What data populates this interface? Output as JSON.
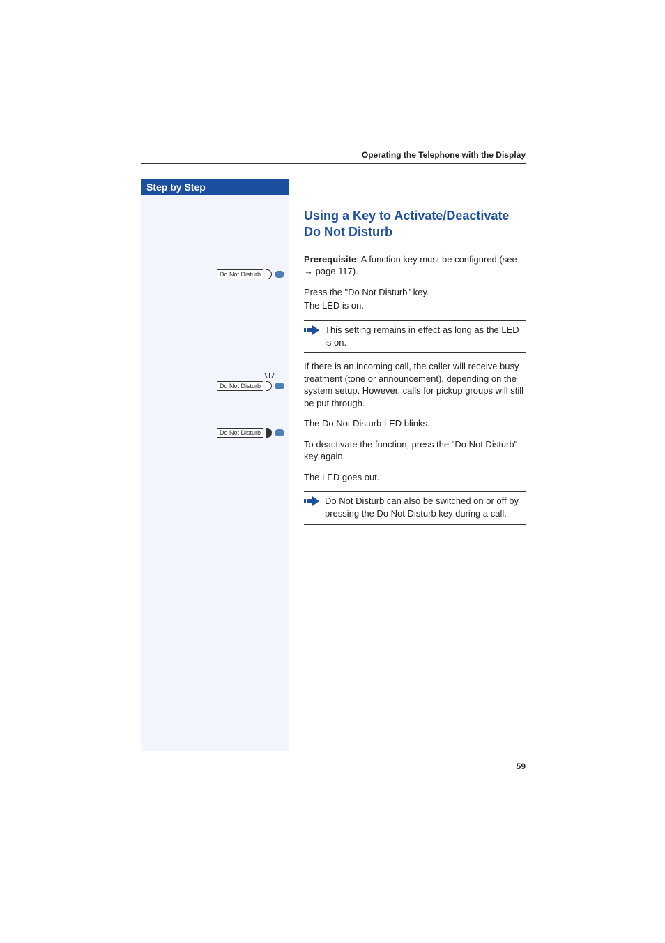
{
  "header": {
    "running_head": "Operating the Telephone with the Display"
  },
  "sidebar": {
    "title": "Step by Step",
    "keys": [
      {
        "label": "Do Not Disturb",
        "led_filled": false,
        "flare": false
      },
      {
        "label": "Do Not Disturb",
        "led_filled": false,
        "flare": true
      },
      {
        "label": "Do Not Disturb",
        "led_filled": true,
        "flare": false
      }
    ]
  },
  "content": {
    "heading": "Using a Key to Activate/Deactivate Do Not Disturb",
    "prereq_label": "Prerequisite",
    "prereq_text": ": A function key must be configured (see ",
    "prereq_arrow": "→",
    "prereq_page": " page 117).",
    "press_line": "Press the \"Do Not Disturb\" key.",
    "led_on_line": "The LED is on.",
    "note1": "This setting remains in effect as long as the LED is on.",
    "busy_para": "If there is an incoming call, the caller will receive busy treatment (tone or announcement), depending on the system setup. However, calls for pickup groups will still be put through.",
    "blinks_line": "The Do Not Disturb LED blinks.",
    "deactivate_line": "To deactivate the function, press the \"Do Not Disturb\" key again.",
    "led_out_line": "The LED goes out.",
    "note2": "Do Not Disturb can also be switched on or off by pressing the Do Not Disturb key during a call."
  },
  "footer": {
    "page_number": "59"
  }
}
